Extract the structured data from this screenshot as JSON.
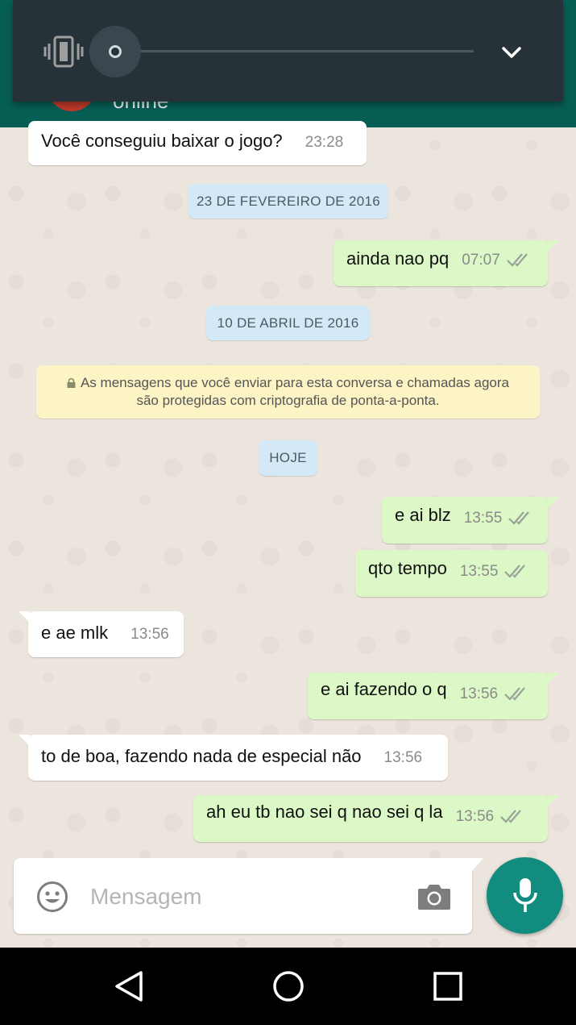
{
  "contact": {
    "status": "online"
  },
  "messages": [
    {
      "text": "Você conseguiu baixar o jogo?",
      "time": "23:28"
    },
    {
      "text": "ainda nao pq",
      "time": "07:07"
    },
    {
      "text": "e ai blz",
      "time": "13:55"
    },
    {
      "text": "qto tempo",
      "time": "13:55"
    },
    {
      "text": "e ae mlk",
      "time": "13:56"
    },
    {
      "text": "e ai fazendo o q",
      "time": "13:56"
    },
    {
      "text": "to de boa, fazendo nada de especial não",
      "time": "13:56"
    },
    {
      "text": "ah eu tb nao sei q nao sei q la",
      "time": "13:56"
    }
  ],
  "dates": [
    "23 DE FEVEREIRO DE 2016",
    "10 DE ABRIL DE 2016",
    "HOJE"
  ],
  "encryption_notice": {
    "line1": "As mensagens que você enviar para esta conversa e chamadas agora",
    "line2": "são protegidas com criptografia de ponta-a-ponta."
  },
  "composer": {
    "placeholder": "Mensagem"
  },
  "colors": {
    "header": "#075e54",
    "outgoing_bubble": "#dcf8c6",
    "incoming_bubble": "#ffffff",
    "mic_button": "#128c7e",
    "read_ticks": "#9aa09a"
  },
  "icons": [
    "vibrate-icon",
    "chevron-down-icon",
    "emoji-icon",
    "camera-icon",
    "mic-icon",
    "back-icon",
    "home-icon",
    "recents-icon",
    "lock-icon",
    "double-check-icon"
  ]
}
